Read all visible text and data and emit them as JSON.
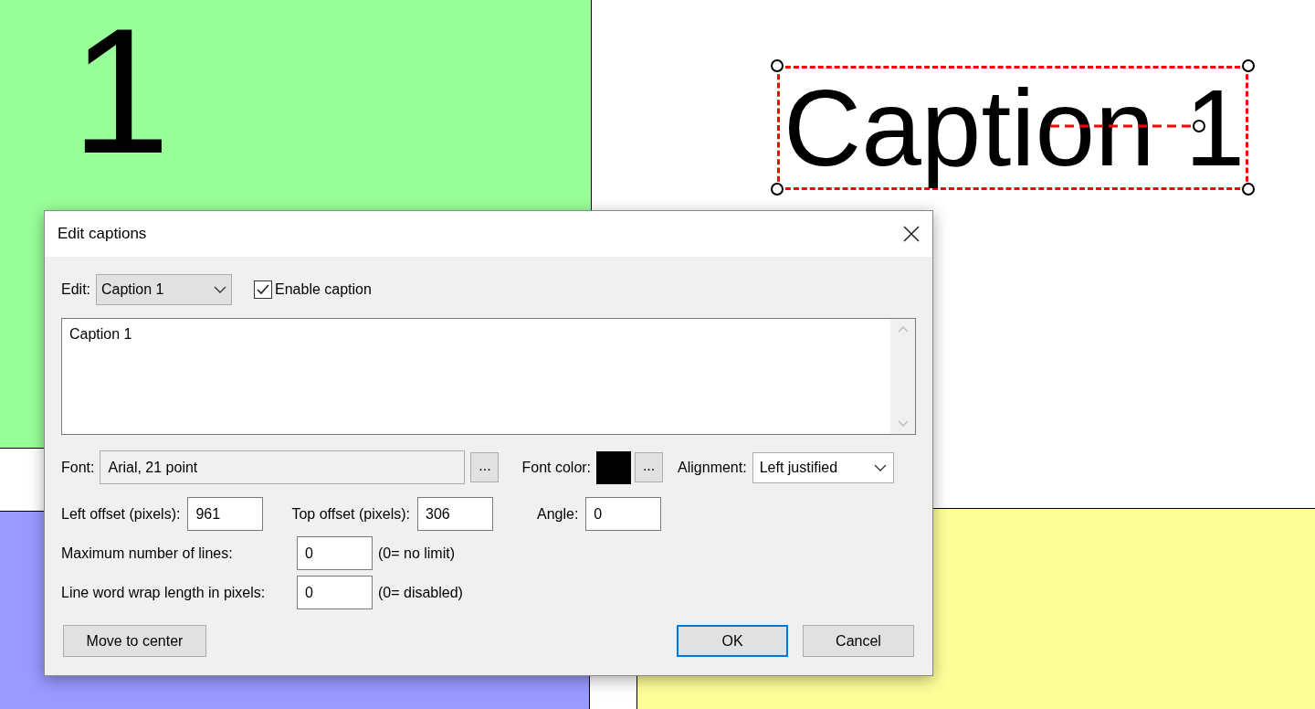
{
  "canvas": {
    "panels": [
      {
        "label": "1",
        "color": "#99ff99"
      },
      {
        "color": "#9999ff"
      },
      {
        "color": "#ffff99"
      }
    ],
    "caption": {
      "text": "Caption 1",
      "selected": true
    }
  },
  "dialog": {
    "title": "Edit captions",
    "edit": {
      "label": "Edit:",
      "value": "Caption 1"
    },
    "enable": {
      "label": "Enable caption",
      "checked": true
    },
    "text": "Caption 1",
    "font": {
      "label": "Font:",
      "value": "Arial, 21 point",
      "button": "..."
    },
    "font_color": {
      "label": "Font color:",
      "color": "#000000",
      "button": "..."
    },
    "alignment": {
      "label": "Alignment:",
      "value": "Left justified"
    },
    "left_offset": {
      "label": "Left offset (pixels):",
      "value": "961"
    },
    "top_offset": {
      "label": "Top offset (pixels):",
      "value": "306"
    },
    "angle": {
      "label": "Angle:",
      "value": "0"
    },
    "max_lines": {
      "label": "Maximum number of lines:",
      "value": "0",
      "hint": "(0= no limit)"
    },
    "wrap": {
      "label": "Line word wrap length in pixels:",
      "value": "0",
      "hint": "(0= disabled)"
    },
    "buttons": [
      {
        "label": "Move to center",
        "default": false
      },
      {
        "label": "OK",
        "default": true
      },
      {
        "label": "Cancel",
        "default": false
      }
    ]
  }
}
